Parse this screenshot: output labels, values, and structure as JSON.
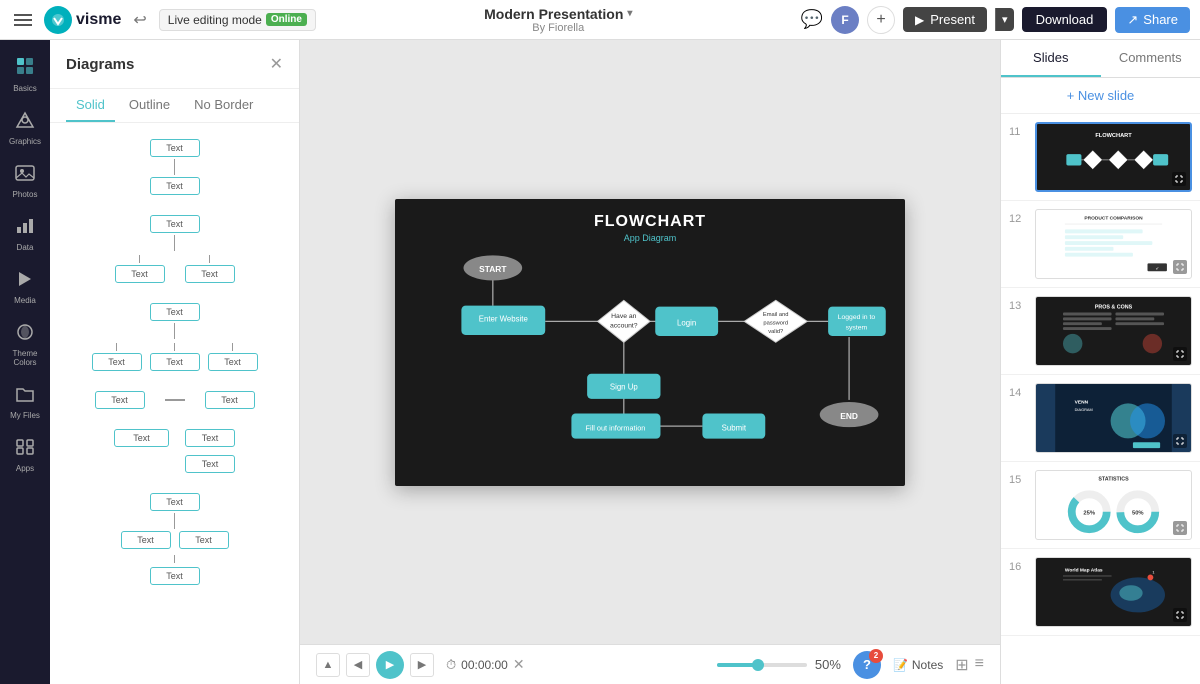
{
  "topbar": {
    "logo_text": "visme",
    "live_edit_label": "Live editing mode",
    "online_label": "Online",
    "presentation_title": "Modern Presentation",
    "presentation_author": "By Fiorella",
    "present_label": "Present",
    "download_label": "Download",
    "share_label": "Share",
    "avatar_initials": "F",
    "comment_icon": "💬",
    "add_icon": "+"
  },
  "sidebar": {
    "items": [
      {
        "id": "basics",
        "label": "Basics",
        "icon": "⊞"
      },
      {
        "id": "graphics",
        "label": "Graphics",
        "icon": "★"
      },
      {
        "id": "photos",
        "label": "Photos",
        "icon": "🖼"
      },
      {
        "id": "data",
        "label": "Data",
        "icon": "📊"
      },
      {
        "id": "media",
        "label": "Media",
        "icon": "▶"
      },
      {
        "id": "theme-colors",
        "label": "Theme Colors",
        "icon": "🎨"
      },
      {
        "id": "my-files",
        "label": "My Files",
        "icon": "📁"
      },
      {
        "id": "apps",
        "label": "Apps",
        "icon": "⊞"
      }
    ]
  },
  "diagrams_panel": {
    "title": "Diagrams",
    "tabs": [
      {
        "id": "solid",
        "label": "Solid",
        "active": true
      },
      {
        "id": "outline",
        "label": "Outline",
        "active": false
      },
      {
        "id": "no-border",
        "label": "No Border",
        "active": false
      }
    ],
    "box_label": "Text"
  },
  "canvas": {
    "flowchart": {
      "title": "FLOWCHART",
      "subtitle": "App Diagram"
    }
  },
  "bottom_controls": {
    "timestamp": "00:00:00",
    "zoom_level": "50%",
    "notes_label": "Notes",
    "help_badge": "2"
  },
  "right_sidebar": {
    "tabs": [
      {
        "id": "slides",
        "label": "Slides",
        "active": true
      },
      {
        "id": "comments",
        "label": "Comments",
        "active": false
      }
    ],
    "new_slide_label": "+ New slide",
    "slides": [
      {
        "number": "11",
        "type": "flowchart",
        "active": true
      },
      {
        "number": "12",
        "type": "product",
        "active": false
      },
      {
        "number": "13",
        "type": "pros",
        "active": false
      },
      {
        "number": "14",
        "type": "donut",
        "active": false
      },
      {
        "number": "15",
        "type": "stats",
        "active": false
      },
      {
        "number": "16",
        "type": "map",
        "active": false
      }
    ]
  }
}
